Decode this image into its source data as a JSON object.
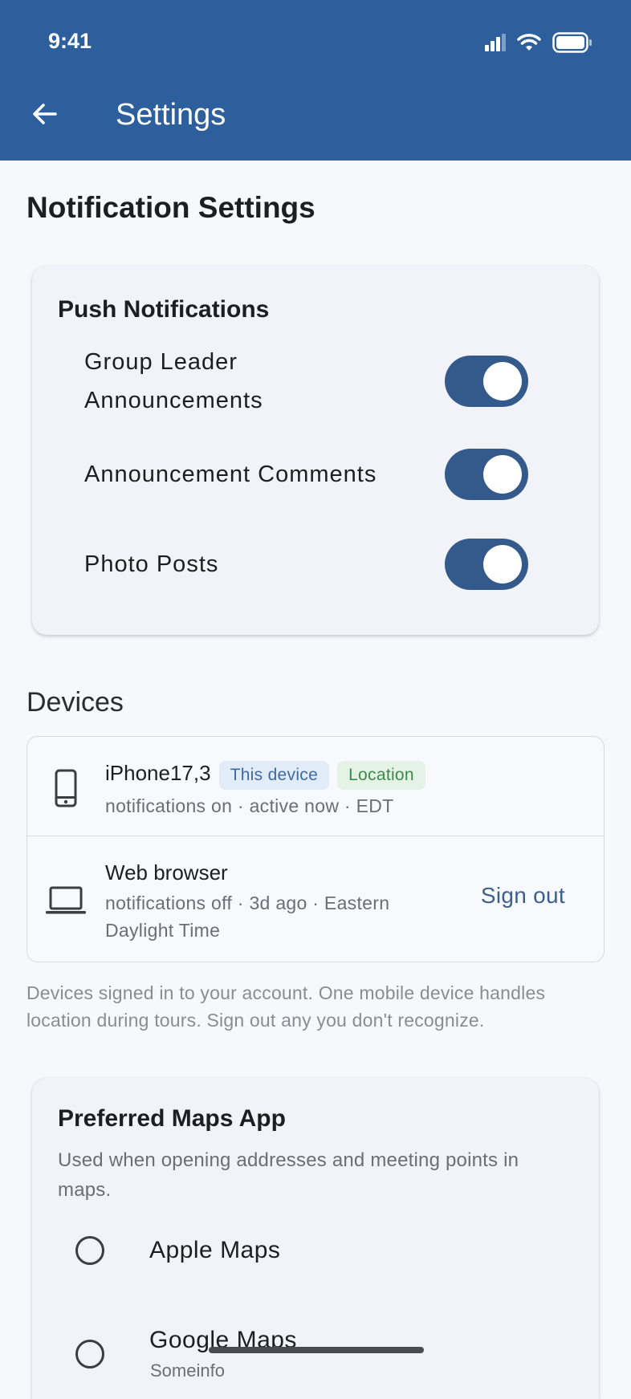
{
  "status_bar": {
    "time": "9:41"
  },
  "app_bar": {
    "title": "Settings"
  },
  "page": {
    "title": "Notification Settings"
  },
  "push_notifications": {
    "title": "Push Notifications",
    "items": [
      {
        "label": "Group Leader Announcements",
        "enabled": true
      },
      {
        "label": "Announcement Comments",
        "enabled": true
      },
      {
        "label": "Photo Posts",
        "enabled": true
      }
    ]
  },
  "devices": {
    "title": "Devices",
    "list": [
      {
        "name": "iPhone17,3",
        "badges": [
          "This device",
          "Location"
        ],
        "meta": "notifications on · active now · EDT",
        "icon": "phone-icon"
      },
      {
        "name": "Web browser",
        "meta": "notifications off · 3d ago · Eastern Daylight Time",
        "action": "Sign out",
        "icon": "laptop-icon"
      }
    ],
    "help": "Devices signed in to your account. One mobile device handles location during tours. Sign out any you don't recognize."
  },
  "maps": {
    "title": "Preferred Maps App",
    "description": "Used when opening addresses and meeting points in maps.",
    "options": [
      {
        "label": "Apple Maps",
        "selected": false
      },
      {
        "label": "Google Maps",
        "selected": false,
        "sub": "Someinfo"
      }
    ]
  },
  "colors": {
    "appbar": "#2c5f9b",
    "switch_on": "#345a8c",
    "chip_blue_bg": "#e2ecf8",
    "chip_green_bg": "#e5f2e6",
    "link": "#3a5f90"
  }
}
